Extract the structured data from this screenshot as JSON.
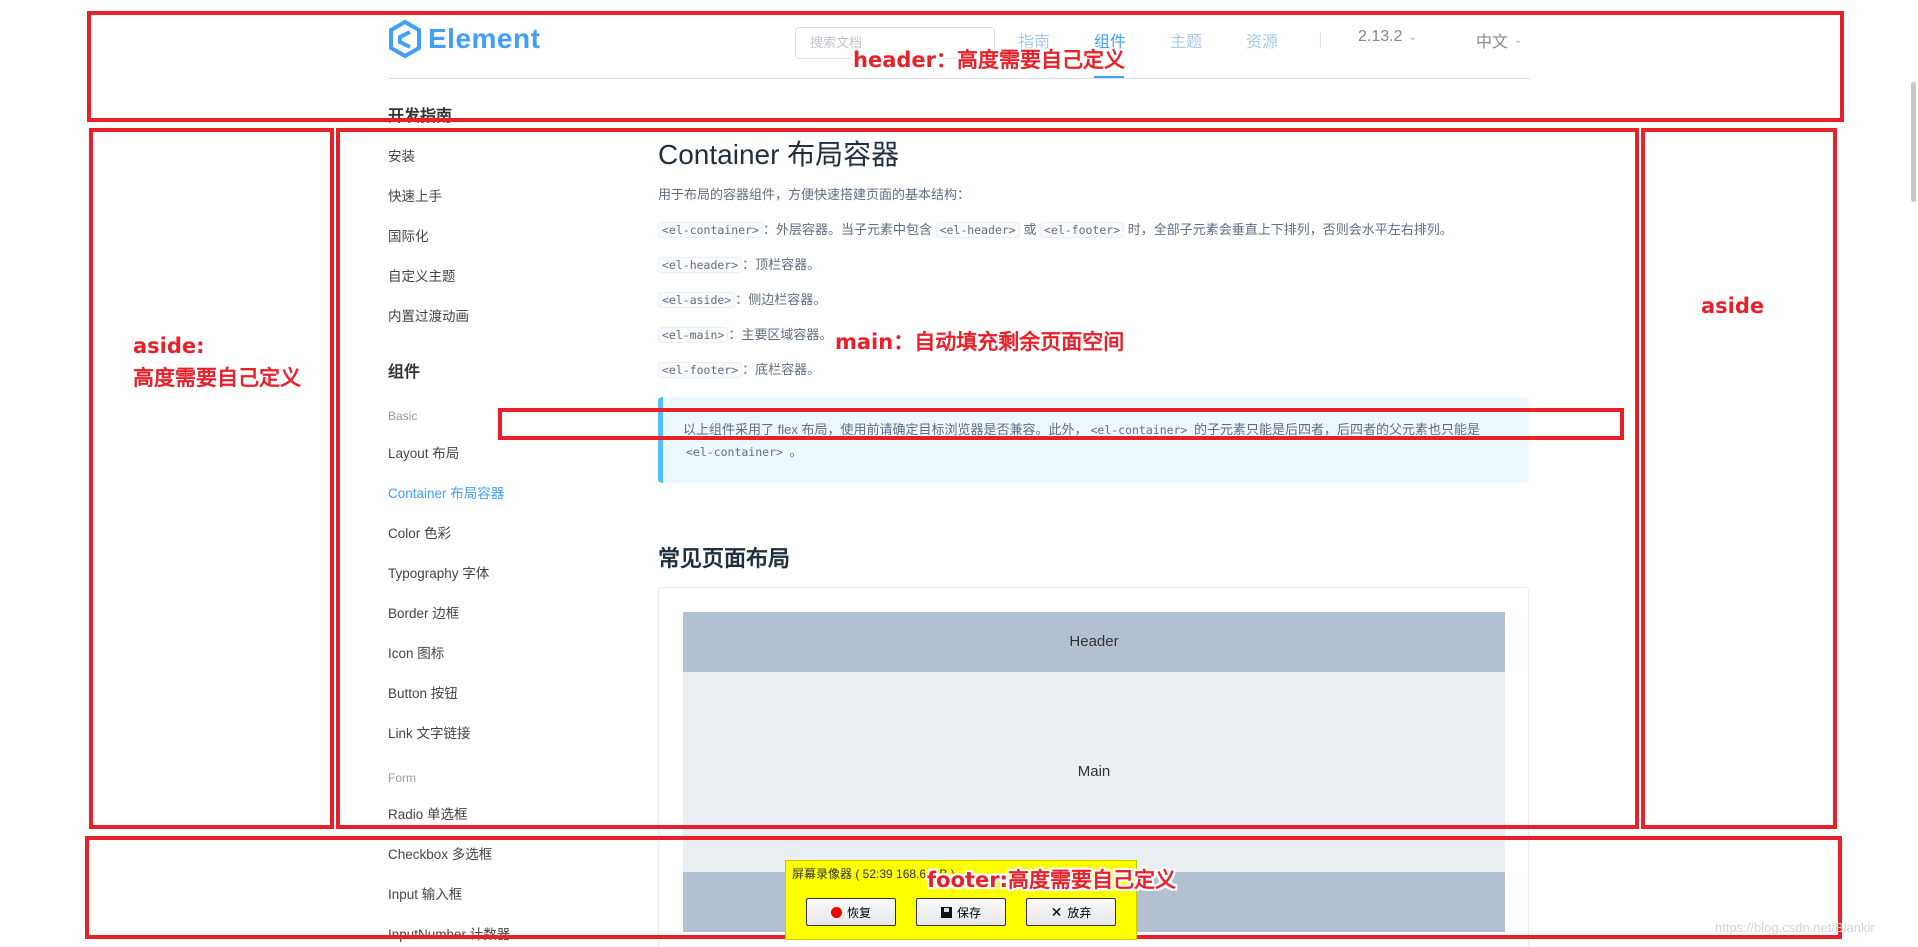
{
  "header": {
    "logo_text": "Element",
    "search_placeholder": "搜索文档",
    "nav": [
      "指南",
      "组件",
      "主题",
      "资源"
    ],
    "active_nav": "组件",
    "version": "2.13.2",
    "language": "中文"
  },
  "sidebar": {
    "dev_guide_title": "开发指南",
    "dev_guide_items": [
      "安装",
      "快速上手",
      "国际化",
      "自定义主题",
      "内置过渡动画"
    ],
    "components_title": "组件",
    "basic_label": "Basic",
    "basic_items": [
      "Layout 布局",
      "Container 布局容器",
      "Color 色彩",
      "Typography 字体",
      "Border 边框",
      "Icon 图标",
      "Button 按钮",
      "Link 文字链接"
    ],
    "active_item": "Container 布局容器",
    "form_label": "Form",
    "form_items": [
      "Radio 单选框",
      "Checkbox 多选框",
      "Input 输入框",
      "InputNumber 计数器"
    ]
  },
  "main": {
    "title": "Container 布局容器",
    "intro": "用于布局的容器组件，方便快速搭建页面的基本结构：",
    "p1": {
      "code1": "<el-container>",
      "t1": "：外层容器。当子元素中包含 ",
      "code2": "<el-header>",
      "t2": " 或 ",
      "code3": "<el-footer>",
      "t3": " 时，全部子元素会垂直上下排列，否则会水平左右排列。"
    },
    "p2": {
      "code": "<el-header>",
      "text": "：顶栏容器。"
    },
    "p3": {
      "code": "<el-aside>",
      "text": "：侧边栏容器。"
    },
    "p4": {
      "code": "<el-main>",
      "text": "：主要区域容器。"
    },
    "p5": {
      "code": "<el-footer>",
      "text": "：底栏容器。"
    },
    "tip": {
      "t1": "以上组件采用了 flex 布局，使用前请确定目标浏览器是否兼容。此外，",
      "code1": "<el-container>",
      "t2": " 的子元素只能是后四者，后四者的父元素也只能是 ",
      "code2": "<el-container>",
      "t3": " 。"
    },
    "subtitle": "常见页面布局",
    "demo": {
      "header": "Header",
      "main": "Main"
    }
  },
  "annotations": {
    "header": "header：高度需要自己定义",
    "aside_left_line1": "aside:",
    "aside_left_line2": "高度需要自己定义",
    "main": "main：自动填充剩余页面空间",
    "aside_right": "aside",
    "footer": "footer:高度需要自己定义",
    "color": "#e8202a"
  },
  "recorder": {
    "title": "屏幕录像器 ( 52:39   168.6 MB )",
    "resume": "恢复",
    "save": "保存",
    "discard": "放弃",
    "background": "#ffff00"
  },
  "watermark": "https://blog.csdn.net/Blankir",
  "colors": {
    "primary": "#409eff",
    "demo_header": "#b3c0d1",
    "demo_main": "#e9eef3"
  }
}
